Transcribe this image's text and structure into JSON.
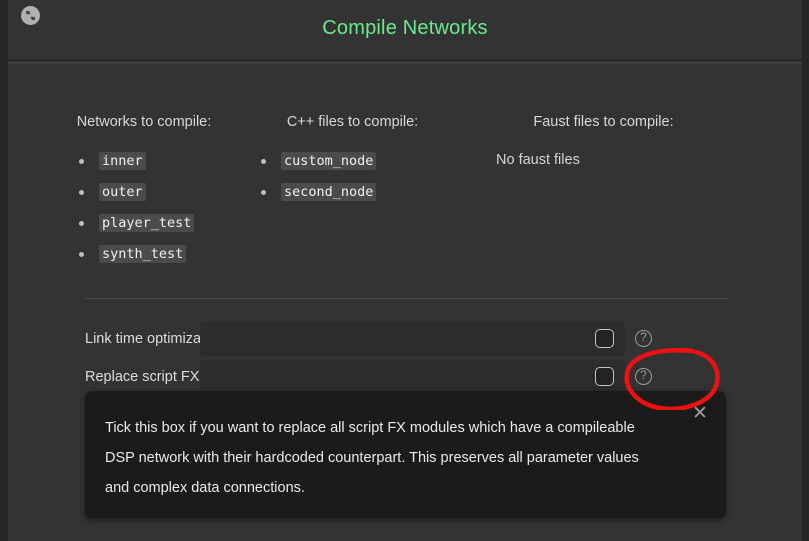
{
  "window": {
    "title": "Compile Networks",
    "title_color": "#69eb8e",
    "restore_icon": "restore-window-icon"
  },
  "columns": [
    {
      "id": "networks",
      "header": "Networks to compile:",
      "items": [
        "inner",
        "outer",
        "player_test",
        "synth_test"
      ],
      "empty_text": ""
    },
    {
      "id": "cpp",
      "header": "C++ files to compile:",
      "items": [
        "custom_node",
        "second_node"
      ],
      "empty_text": ""
    },
    {
      "id": "faust",
      "header": "Faust files to compile:",
      "items": [],
      "empty_text": "No faust files"
    }
  ],
  "settings": [
    {
      "id": "link-time-optimization",
      "label": "Link time optimization",
      "checked": false,
      "help": "?"
    },
    {
      "id": "replace-script-fx-modules",
      "label": "Replace script FX modules",
      "checked": false,
      "help": "?"
    }
  ],
  "tooltip": {
    "text": "Tick this box if you want to replace all script FX modules which have a compileable DSP network with their hardcoded counterpart. This preserves all parameter values and complex data connections.",
    "close_label": "✕"
  },
  "annotation": {
    "color": "#ee1111",
    "shape": "hand-drawn-ellipse"
  }
}
